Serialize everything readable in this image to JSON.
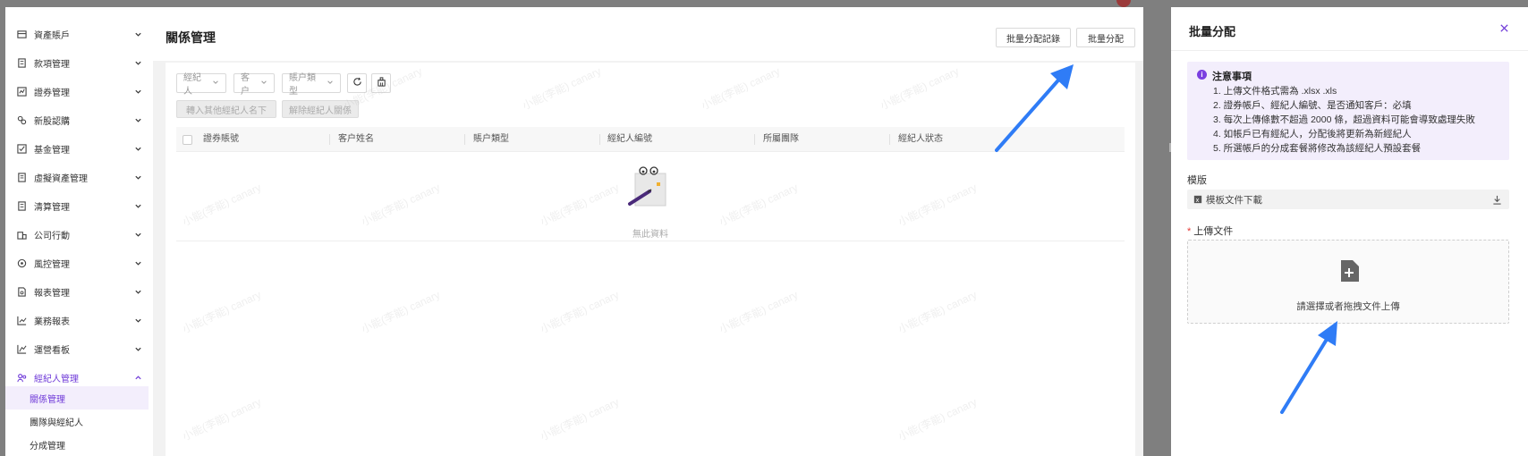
{
  "sidebar": {
    "items": [
      {
        "label": "資產賬戶",
        "icon": "account-icon"
      },
      {
        "label": "款項管理",
        "icon": "money-icon"
      },
      {
        "label": "證券管理",
        "icon": "securities-icon"
      },
      {
        "label": "新股認購",
        "icon": "ipo-icon"
      },
      {
        "label": "基金管理",
        "icon": "fund-icon"
      },
      {
        "label": "虛擬資產管理",
        "icon": "virtual-asset-icon"
      },
      {
        "label": "清算管理",
        "icon": "clearing-icon"
      },
      {
        "label": "公司行動",
        "icon": "corporate-action-icon"
      },
      {
        "label": "風控管理",
        "icon": "risk-icon"
      },
      {
        "label": "報表管理",
        "icon": "report-icon"
      },
      {
        "label": "業務報表",
        "icon": "business-chart-icon"
      },
      {
        "label": "運營看板",
        "icon": "dashboard-icon"
      },
      {
        "label": "經紀人管理",
        "icon": "broker-icon"
      }
    ],
    "sub_items": [
      {
        "label": "關係管理"
      },
      {
        "label": "團隊與經紀人"
      },
      {
        "label": "分成管理"
      }
    ]
  },
  "main": {
    "title": "關係管理",
    "batch_record_label": "批量分配記錄",
    "batch_assign_label": "批量分配",
    "filters": {
      "broker": "經紀人",
      "customer": "客户",
      "account_type": "賬户類型"
    },
    "transfer_btn": "轉入其他經紀人名下",
    "remove_btn": "解除經紀人關係",
    "columns": [
      "證券賬號",
      "客户姓名",
      "賬户類型",
      "經紀人編號",
      "所屬團隊",
      "經紀人狀态"
    ],
    "empty_text": "無此資料"
  },
  "drawer": {
    "title": "批量分配",
    "notice_title": "注意事項",
    "notice_lines": [
      "1. 上傳文件格式需為 .xlsx .xls",
      "2. 證券帳戶、經紀人編號、是否通知客戶：必填",
      "3. 每次上傳條數不超過 2000 條，超過資料可能會導致處理失敗",
      "4. 如帳戶已有經紀人，分配後將更新為新經紀人",
      "5. 所選帳戶的分成套餐將修改為該經紀人預設套餐"
    ],
    "template_label": "模版",
    "template_download": "模板文件下載",
    "upload_label": "上傳文件",
    "upload_hint": "請選擇或者拖拽文件上傳"
  },
  "colors": {
    "accent": "#6f3ad8",
    "arrow": "#2f7cf6",
    "notice_bg": "#f3eefc"
  },
  "watermark": "小能(李能) canary"
}
